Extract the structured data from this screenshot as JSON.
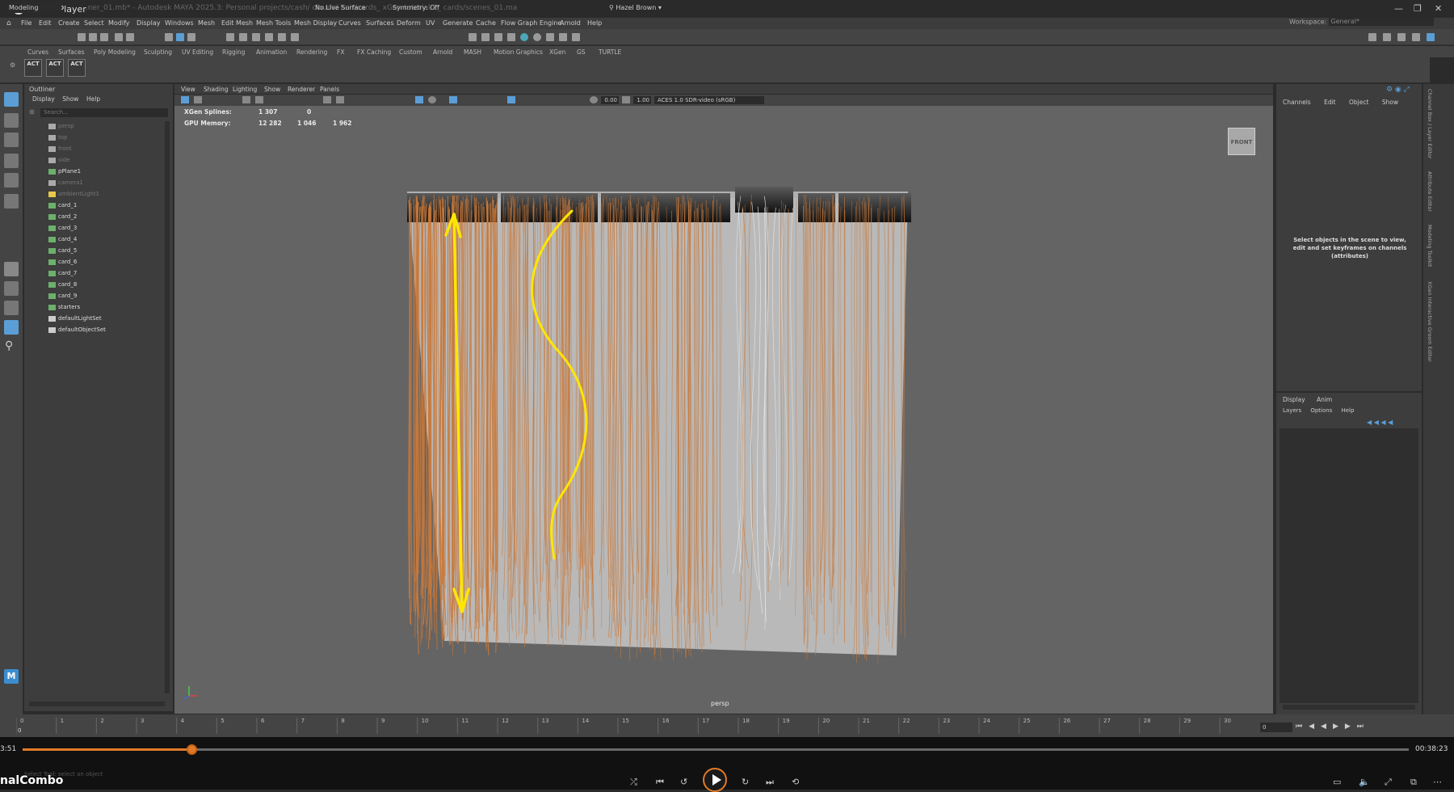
{
  "window": {
    "title": "Media Player",
    "maya_title": "...ner_01.mb* - Autodesk MAYA 2025.3: Personal projects/cash/ clouds/ hair/cards_ xGen tutorial/2_ cards/scenes_01.ma"
  },
  "menubar": [
    "File",
    "Edit",
    "Create",
    "Select",
    "Modify",
    "Display",
    "Windows",
    "Mesh",
    "Edit Mesh",
    "Mesh Tools",
    "Mesh Display",
    "Curves",
    "Surfaces",
    "Deform",
    "UV",
    "Generate",
    "Cache",
    "Flow Graph Engine",
    "Arnold",
    "Help"
  ],
  "workspace": {
    "label": "Workspace:",
    "value": "General*"
  },
  "statusline": {
    "mode": "Modeling",
    "live_surface": "No Live Surface",
    "symmetry": "Symmetry: Off",
    "user": "Hazel Brown"
  },
  "shelf_tabs": [
    "Curves",
    "Surfaces",
    "Poly Modeling",
    "Sculpting",
    "UV Editing",
    "Rigging",
    "Animation",
    "Rendering",
    "FX",
    "FX Caching",
    "Custom",
    "Arnold",
    "MASH",
    "Motion Graphics",
    "XGen",
    "GS",
    "TURTLE"
  ],
  "shelf_icons": [
    "ACT",
    "ACT",
    "ACT"
  ],
  "outliner": {
    "tab": "Outliner",
    "menu": [
      "Display",
      "Show",
      "Help"
    ],
    "search_placeholder": "Search...",
    "items": [
      {
        "label": "persp",
        "dim": true
      },
      {
        "label": "top",
        "dim": true
      },
      {
        "label": "front",
        "dim": true
      },
      {
        "label": "side",
        "dim": true
      },
      {
        "label": "pPlane1",
        "dim": false
      },
      {
        "label": "camera1",
        "dim": true
      },
      {
        "label": "ambientLight1",
        "dim": true
      },
      {
        "label": "card_1",
        "dim": false
      },
      {
        "label": "card_2",
        "dim": false
      },
      {
        "label": "card_3",
        "dim": false
      },
      {
        "label": "card_4",
        "dim": false
      },
      {
        "label": "card_5",
        "dim": false
      },
      {
        "label": "card_6",
        "dim": false
      },
      {
        "label": "card_7",
        "dim": false
      },
      {
        "label": "card_8",
        "dim": false
      },
      {
        "label": "card_9",
        "dim": false
      },
      {
        "label": "starters",
        "dim": false
      },
      {
        "label": "defaultLightSet",
        "dim": false
      },
      {
        "label": "defaultObjectSet",
        "dim": false
      }
    ]
  },
  "viewport": {
    "menu": [
      "View",
      "Shading",
      "Lighting",
      "Show",
      "Renderer",
      "Panels"
    ],
    "exposure": "0.00",
    "gamma": "1.00",
    "color_space": "ACES 1.0 SDR-video (sRGB)",
    "hud": {
      "xgen_label": "XGen Splines:",
      "xgen_values": [
        "1 307",
        "0"
      ],
      "gpu_label": "GPU Memory:",
      "gpu_values": [
        "12 282",
        "1 046",
        "1 962"
      ]
    },
    "cube_label": "FRONT",
    "camera": "persp"
  },
  "channel_box": {
    "menu": [
      "Channels",
      "Edit",
      "Object",
      "Show"
    ],
    "message": "Select objects in the scene to view, edit and set keyframes on channels (attributes)"
  },
  "layer_editor": {
    "tabs": [
      "Display",
      "Anim"
    ],
    "menu": [
      "Layers",
      "Options",
      "Help"
    ]
  },
  "side_tabs": [
    "Channel Box / Layer Editor",
    "Attribute Editor",
    "Modeling Toolkit",
    "XGen Interactive Groom Editor"
  ],
  "timeline": {
    "ticks": [
      "0",
      "1",
      "2",
      "3",
      "4",
      "5",
      "6",
      "7",
      "8",
      "9",
      "10",
      "11",
      "12",
      "13",
      "14",
      "15",
      "16",
      "17",
      "18",
      "19",
      "20",
      "21",
      "22",
      "23",
      "24",
      "25",
      "26",
      "27",
      "28",
      "29",
      "30"
    ],
    "current_frame": "0",
    "start_frame": "0"
  },
  "help_line": "Select Tool: select an object",
  "player": {
    "current_time": "3:51",
    "total_time": "00:38:23",
    "progress": 0.122,
    "track": "nalCombo"
  },
  "colors": {
    "accent": "#e07a28",
    "hair": "#c9793a",
    "annotation": "#ffe600"
  }
}
